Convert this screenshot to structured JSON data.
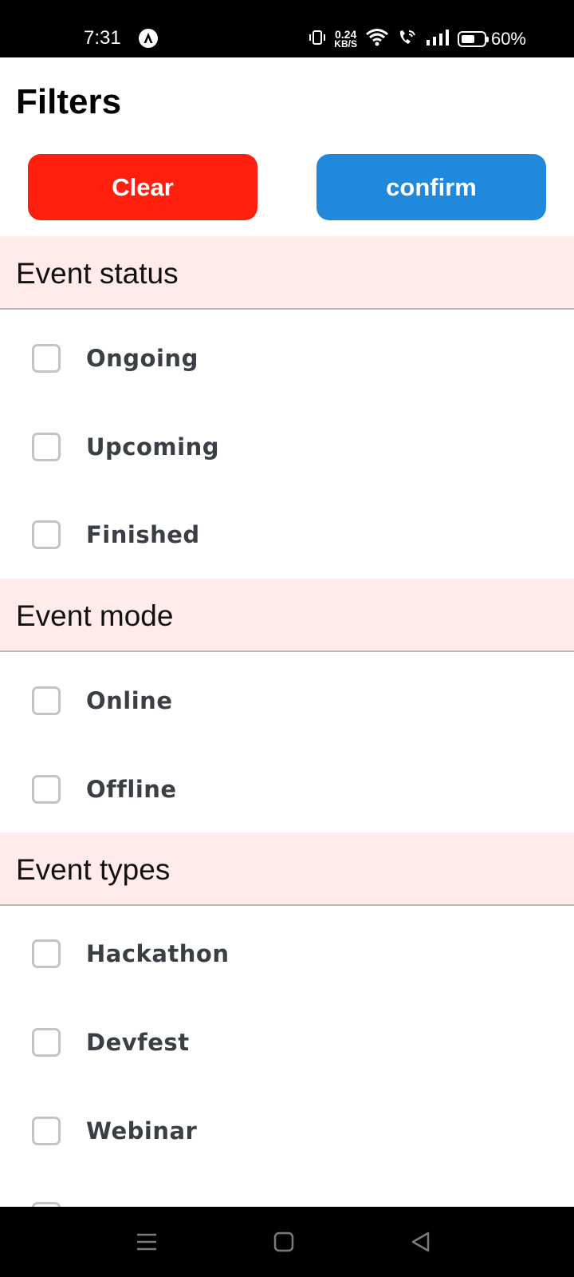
{
  "status_bar": {
    "time": "7:31",
    "network_speed_value": "0.24",
    "network_speed_unit": "KB/S",
    "battery_percent": "60%",
    "battery_level": 0.6,
    "icons": [
      "notification-a-icon",
      "vibrate-icon",
      "wifi-icon",
      "wifi-call-icon",
      "signal-icon",
      "battery-icon"
    ]
  },
  "header": {
    "title": "Filters",
    "clear_label": "Clear",
    "confirm_label": "confirm"
  },
  "colors": {
    "clear_button": "#fe1f0e",
    "confirm_button": "#2189dc",
    "section_header_bg": "#ffebea",
    "checkbox_border": "#c4c4c4",
    "option_text": "#3a3f45"
  },
  "sections": [
    {
      "title": "Event status",
      "options": [
        {
          "label": "Ongoing",
          "checked": false
        },
        {
          "label": "Upcoming",
          "checked": false
        },
        {
          "label": "Finished",
          "checked": false
        }
      ]
    },
    {
      "title": "Event mode",
      "options": [
        {
          "label": "Online",
          "checked": false
        },
        {
          "label": "Offline",
          "checked": false
        }
      ]
    },
    {
      "title": "Event types",
      "options": [
        {
          "label": "Hackathon",
          "checked": false
        },
        {
          "label": "Devfest",
          "checked": false
        },
        {
          "label": "Webinar",
          "checked": false
        }
      ]
    }
  ],
  "nav_bar": {
    "icons": [
      "menu-icon",
      "home-icon",
      "back-icon"
    ]
  }
}
